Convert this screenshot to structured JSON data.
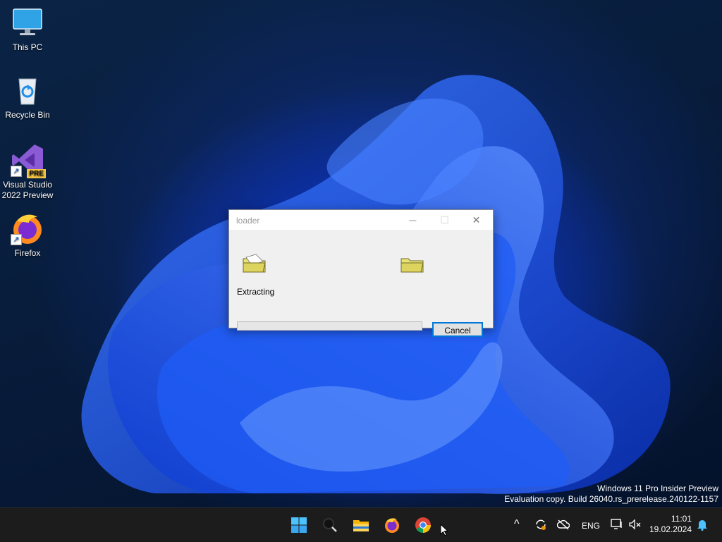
{
  "desktop": {
    "icons": [
      {
        "label": "This PC"
      },
      {
        "label": "Recycle Bin"
      },
      {
        "label_line1": "Visual Studio",
        "label_line2": "2022 Preview",
        "badge": "PRE"
      },
      {
        "label": "Firefox"
      }
    ]
  },
  "dialog": {
    "title": "loader",
    "minimize_glyph": "─",
    "maximize_glyph": "☐",
    "close_glyph": "✕",
    "status": "Extracting",
    "progress_percent": 0,
    "cancel_label": "Cancel"
  },
  "watermark": {
    "line1": "Windows 11 Pro Insider Preview",
    "line2": "Evaluation copy. Build 26040.rs_prerelease.240122-1157"
  },
  "taskbar": {
    "apps": [
      "start-icon",
      "search-icon",
      "file-explorer-icon",
      "firefox-icon",
      "chrome-icon"
    ],
    "tray": {
      "chevron": "^",
      "language": "ENG",
      "time": "11:01",
      "date": "19.02.2024"
    }
  },
  "colors": {
    "accent": "#0078d7",
    "taskbar": "#1c1c1c",
    "wallpaper_blue": "#1a4fe0"
  }
}
